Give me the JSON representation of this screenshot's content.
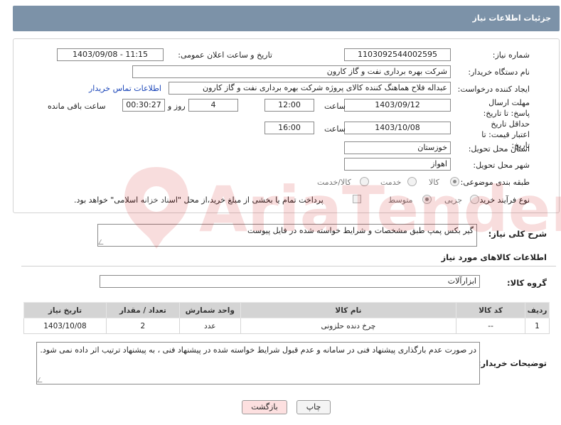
{
  "header": {
    "title": "جزئیات اطلاعات نیاز"
  },
  "form": {
    "need_number": {
      "label": "شماره نیاز:",
      "value": "1103092544002595"
    },
    "announce": {
      "label": "تاریخ و ساعت اعلان عمومی:",
      "value": "1403/09/08 - 11:15"
    },
    "buyer": {
      "label": "نام دستگاه خریدار:",
      "value": "شرکت بهره برداری نفت و گاز کارون"
    },
    "creator": {
      "label": "ایجاد کننده درخواست:",
      "value": "عبداله فلاح هماهنگ کننده کالای پروژه شرکت بهره برداری نفت و گاز کارون",
      "contact_link": "اطلاعات تماس خریدار"
    },
    "deadline": {
      "label": "مهلت ارسال پاسخ: تا تاریخ:",
      "date": "1403/09/12",
      "time_label": "ساعت",
      "time": "12:00",
      "days": "4",
      "days_label": "روز و",
      "remaining": "00:30:27",
      "remaining_label": "ساعت باقی مانده"
    },
    "validity": {
      "label": "حداقل تاریخ اعتبار قیمت: تا تاریخ:",
      "date": "1403/10/08",
      "time_label": "ساعت",
      "time": "16:00"
    },
    "province": {
      "label": "استان محل تحویل:",
      "value": "خوزستان"
    },
    "city": {
      "label": "شهر محل تحویل:",
      "value": "اهواز"
    },
    "category": {
      "label": "طبقه بندی موضوعی:",
      "options": [
        "کالا",
        "خدمت",
        "کالا/خدمت"
      ]
    },
    "process": {
      "label": "نوع فرآیند خرید :",
      "options": [
        "جزیی",
        "متوسط"
      ],
      "payment_note": "پرداخت تمام یا بخشی از مبلغ خرید،از محل \"اسناد خزانه اسلامی\" خواهد بود."
    },
    "description": {
      "label": "شرح کلی نیاز:",
      "value": "گیر بکس پمپ طبق مشخصات و شرایط خواسته شده در فایل پیوست"
    }
  },
  "goods": {
    "section_title": "اطلاعات کالاهای مورد نیاز",
    "group_label": "گروه کالا:",
    "group_value": "ابزارآلات",
    "columns": [
      "ردیف",
      "کد کالا",
      "نام کالا",
      "واحد شمارش",
      "تعداد / مقدار",
      "تاریخ نیاز"
    ],
    "rows": [
      [
        "1",
        "--",
        "چرخ دنده حلزونی",
        "عدد",
        "2",
        "1403/10/08"
      ]
    ]
  },
  "buyer_notes": {
    "label": "توضیحات خریدار:",
    "value": "در صورت عدم بارگذاری پیشنهاد فنی در سامانه و عدم قبول شرایط خواسته شده در پیشنهاد فنی ، به پیشنهاد ترتیب اثر داده نمی شود."
  },
  "buttons": {
    "print": "چاپ",
    "back": "بازگشت"
  },
  "watermark": {
    "text": "AriaTender.net"
  },
  "colors": {
    "header_bg": "#7c92a8",
    "link": "#1a45b8",
    "table_header_bg": "#d4d4d4",
    "back_button_bg": "#fde0e0"
  }
}
